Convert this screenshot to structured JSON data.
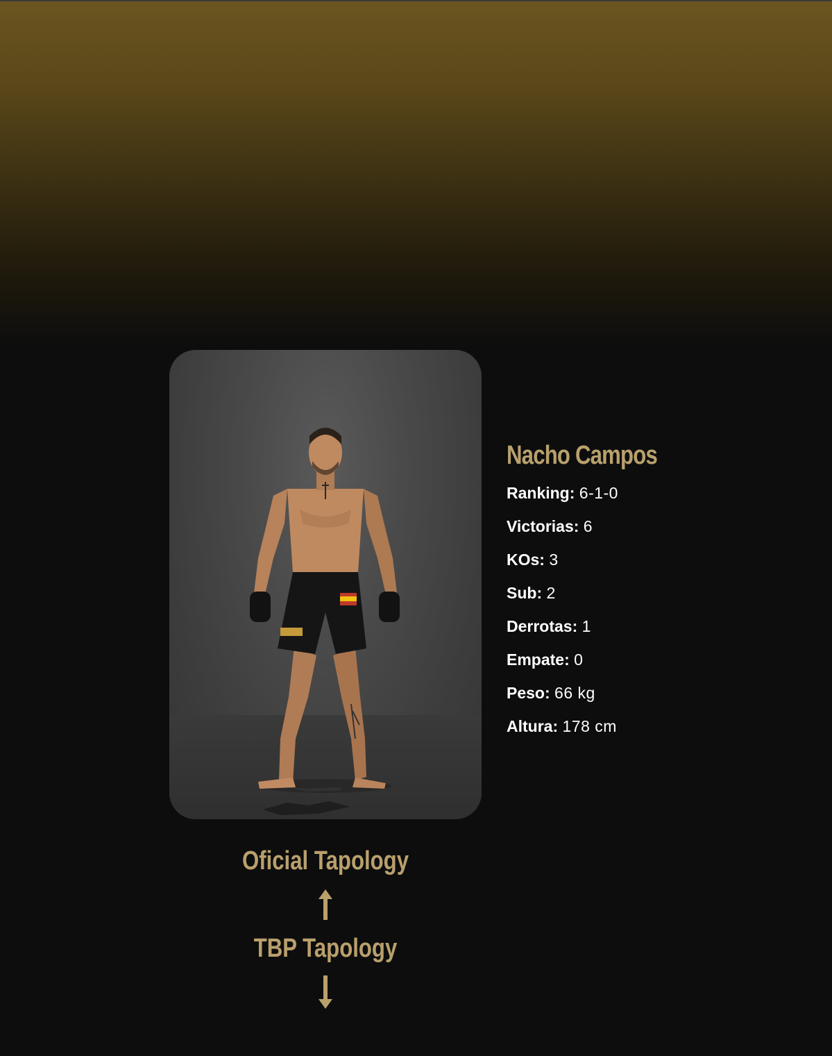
{
  "fighter": {
    "name": "Nacho Campos",
    "photo_alt": "Nacho Campos",
    "stats": [
      {
        "label": "Ranking:",
        "value": "6-1-0"
      },
      {
        "label": "Victorias:",
        "value": "6"
      },
      {
        "label": "KOs:",
        "value": "3"
      },
      {
        "label": "Sub:",
        "value": "2"
      },
      {
        "label": "Derrotas:",
        "value": "1"
      },
      {
        "label": "Empate:",
        "value": "0"
      },
      {
        "label": "Peso:",
        "value": "66 kg"
      },
      {
        "label": "Altura:",
        "value": "178 cm"
      }
    ]
  },
  "links": {
    "official": {
      "label": "Oficial Tapology",
      "icon": "arrow-up-icon"
    },
    "tbp": {
      "label": "TBP Tapology",
      "icon": "arrow-down-icon"
    }
  },
  "colors": {
    "accent": "#b9a06c",
    "background": "#0d0d0d",
    "hero_top": "#6b5520",
    "text": "#ffffff"
  }
}
